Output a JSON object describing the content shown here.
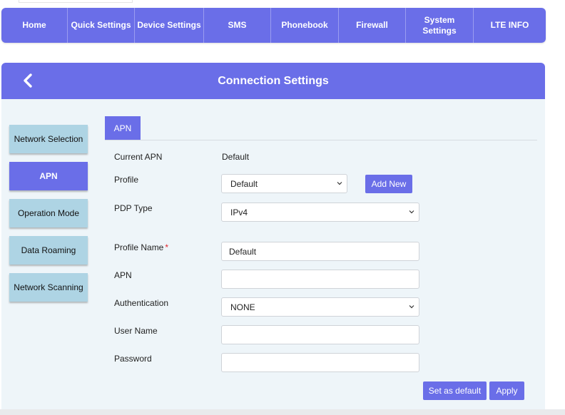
{
  "topnav": {
    "items": [
      {
        "label": "Home"
      },
      {
        "label": "Quick Settings"
      },
      {
        "label": "Device Settings"
      },
      {
        "label": "SMS"
      },
      {
        "label": "Phonebook"
      },
      {
        "label": "Firewall"
      },
      {
        "label": "System Settings"
      },
      {
        "label": "LTE INFO"
      }
    ]
  },
  "panel": {
    "title": "Connection Settings",
    "back_icon": "chevron-left-icon"
  },
  "sidebar": {
    "items": [
      {
        "label": "Network Selection",
        "active": false
      },
      {
        "label": "APN",
        "active": true
      },
      {
        "label": "Operation Mode",
        "active": false
      },
      {
        "label": "Data Roaming",
        "active": false
      },
      {
        "label": "Network Scanning",
        "active": false
      }
    ]
  },
  "apn": {
    "tab_label": "APN",
    "current_apn_label": "Current APN",
    "current_apn_value": "Default",
    "profile_label": "Profile",
    "profile_value": "Default",
    "add_new_label": "Add New",
    "pdp_type_label": "PDP Type",
    "pdp_type_value": "IPv4",
    "profile_name_label": "Profile Name",
    "required_mark": "*",
    "profile_name_value": "Default",
    "apn_label": "APN",
    "apn_value": "",
    "authentication_label": "Authentication",
    "authentication_value": "NONE",
    "user_name_label": "User Name",
    "user_name_value": "",
    "password_label": "Password",
    "password_value": "",
    "set_default_label": "Set as default",
    "apply_label": "Apply"
  },
  "colors": {
    "accent": "#6a6ee8",
    "side_tab": "#aed4e4",
    "panel_bg": "#eef5f9",
    "required": "#e0242b"
  }
}
